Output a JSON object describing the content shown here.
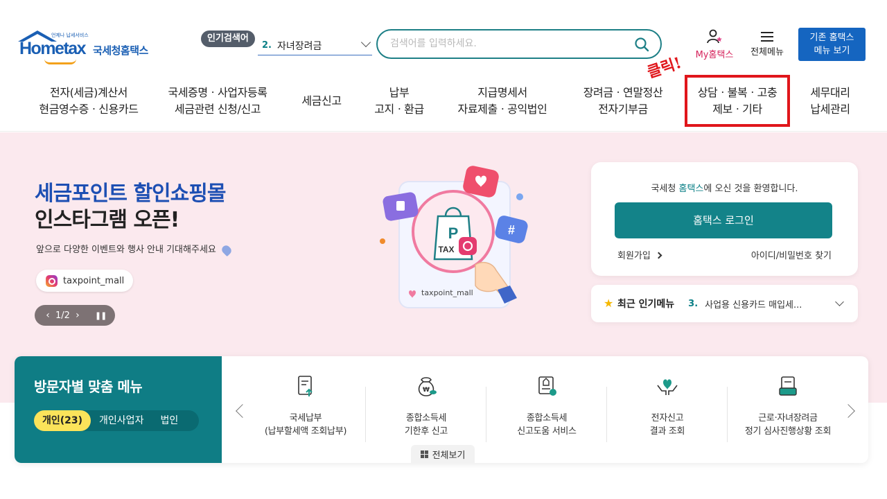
{
  "header": {
    "logo": {
      "wordmark": "Hometax",
      "tagline": "언제나 납세서비스",
      "name": "국세청홈택스"
    },
    "popular_badge": "인기검색어",
    "popular_search": {
      "rank": "2.",
      "term": "자녀장려금"
    },
    "search": {
      "placeholder": "검색어를 입력하세요."
    },
    "my_hometax": "My홈택스",
    "all_menu": "전체메뉴",
    "legacy_button": {
      "line1": "기존 홈택스",
      "line2": "메뉴 보기"
    }
  },
  "gnb": [
    {
      "label": "전자(세금)계산서\n현금영수증ㆍ신용카드"
    },
    {
      "label": "국세증명ㆍ사업자등록\n세금관련 신청/신고"
    },
    {
      "label": "세금신고"
    },
    {
      "label": "납부\n고지ㆍ환급"
    },
    {
      "label": "지급명세서\n자료제출ㆍ공익법인"
    },
    {
      "label": "장려금ㆍ연말정산\n전자기부금"
    },
    {
      "label": "상담ㆍ불복ㆍ고충\n제보ㆍ기타"
    },
    {
      "label": "세무대리\n납세관리"
    }
  ],
  "annotation": {
    "text": "클릭!",
    "color": "#e0161b"
  },
  "hero": {
    "title_line1": "세금포인트 할인쇼핑몰",
    "title_line2": "인스타그램 오픈!",
    "description": "앞으로 다양한 이벤트와 행사 안내 기대해주세요",
    "instagram_handle": "taxpoint_mall",
    "pager": {
      "current": "1",
      "total": "2",
      "text": "1/2"
    },
    "illustration_handle": "taxpoint_mall",
    "illustration_bag_letter": "P",
    "illustration_bag_text": "TAX",
    "illustration_hash": "#"
  },
  "login": {
    "welcome_prefix": "국세청 ",
    "welcome_brand": "홈택스",
    "welcome_suffix": "에 오신 것을 환영합니다.",
    "login_button": "홈택스 로그인",
    "join_link": "회원가입",
    "find_link": "아이디/비밀번호 찾기"
  },
  "popular_menu": {
    "title": "최근 인기메뉴",
    "rank": "3.",
    "item": "사업용 신용카드 매입세..."
  },
  "visitor_menu": {
    "title": "방문자별 맞춤 메뉴",
    "tabs": [
      {
        "label": "개인(23)",
        "active": true
      },
      {
        "label": "개인사업자",
        "active": false
      },
      {
        "label": "법인",
        "active": false
      }
    ],
    "items": [
      {
        "label": "국세납부\n(납부할세액 조회납부)",
        "icon": "document-upload-icon"
      },
      {
        "label": "종합소득세\n기한후 신고",
        "icon": "money-bag-icon"
      },
      {
        "label": "종합소득세\n신고도움 서비스",
        "icon": "document-award-icon"
      },
      {
        "label": "전자신고\n결과 조회",
        "icon": "heart-hands-icon"
      },
      {
        "label": "근로·자녀장려금\n정기 심사진행상황 조회",
        "icon": "document-stack-icon"
      }
    ],
    "view_all": "전체보기"
  },
  "colors": {
    "brand_blue": "#1a5fb4",
    "teal": "#138389",
    "hero_bg": "#fbe9ee",
    "active_tab": "#fbe35a",
    "my_hometax": "#d5245c"
  }
}
